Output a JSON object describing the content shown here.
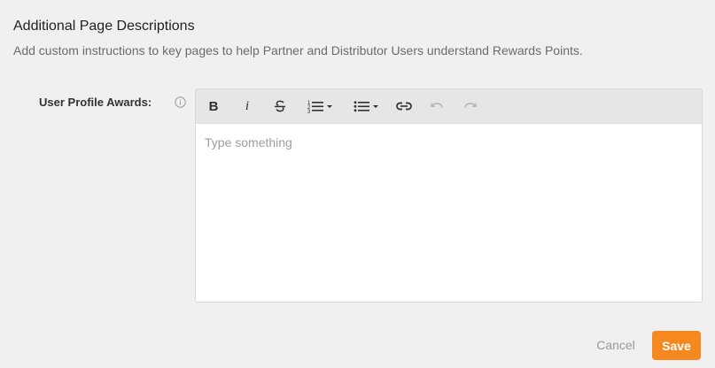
{
  "section": {
    "title": "Additional Page Descriptions",
    "subtitle": "Add custom instructions to key pages to help Partner and Distributor Users understand Rewards Points."
  },
  "field": {
    "label": "User Profile Awards:",
    "placeholder": "Type something"
  },
  "toolbar": {
    "bold": "B",
    "italic": "i",
    "icons": [
      "bold-icon",
      "italic-icon",
      "strikethrough-icon",
      "ordered-list-icon",
      "bullet-list-icon",
      "link-icon",
      "undo-icon",
      "redo-icon"
    ]
  },
  "actions": {
    "cancel": "Cancel",
    "save": "Save"
  },
  "colors": {
    "accent": "#f5881f",
    "background": "#f0f0f0",
    "toolbar": "#e6e6e6"
  }
}
